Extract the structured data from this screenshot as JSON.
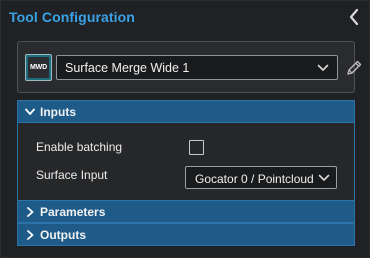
{
  "header": {
    "title": "Tool Configuration"
  },
  "tool": {
    "icon_text": "MWD",
    "selected": "Surface Merge Wide 1"
  },
  "sections": {
    "inputs": {
      "label": "Inputs",
      "expanded": true,
      "fields": {
        "enable_batching_label": "Enable batching",
        "enable_batching_checked": false,
        "surface_input_label": "Surface Input",
        "surface_input_value": "Gocator 0 / Pointcloud"
      }
    },
    "parameters": {
      "label": "Parameters",
      "expanded": false
    },
    "outputs": {
      "label": "Outputs",
      "expanded": false
    }
  },
  "colors": {
    "accent": "#3aa3e6",
    "section_header": "#1e5b88",
    "tool_icon": "#1d6f7f"
  },
  "icons": {
    "collapse": "chevron-left-icon",
    "dropdown": "chevron-down-icon",
    "edit": "pencil-icon",
    "section_expanded": "chevron-down-icon",
    "section_collapsed": "chevron-right-icon"
  }
}
